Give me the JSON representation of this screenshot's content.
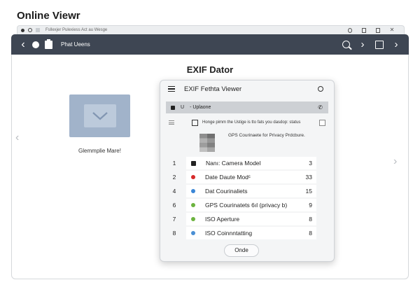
{
  "app_title": "Online Viewr",
  "browser_bar": {
    "tabs_text": "Fsllexjer  Pulexiess   Act au Wesge"
  },
  "toolbar": {
    "title": "Phat Ueens",
    "bg_color": "#3e4653"
  },
  "main": {
    "heading": "EXIF Dator",
    "thumbnail_caption": "Glemmplie Mare!"
  },
  "dialog": {
    "title": "EXIF Fethta Viewer",
    "subbar_lock_label": "U",
    "subbar_label": "- Uplaone",
    "message": "Honge pimm the Ustige is tto fats you dasdop: status",
    "gps_note": "GPS Courinaete for Privacy Prdcbure.",
    "rows": [
      {
        "num": "1",
        "label": "Nanı: Camera Model",
        "value": "3",
        "icon_color": "#222222",
        "icon": "document-icon"
      },
      {
        "num": "2",
        "label": "Date Daute Modᶜ",
        "value": "33",
        "icon_color": "#d62a2a",
        "icon": "red-dot-icon"
      },
      {
        "num": "4",
        "label": "Dat Courinaliets",
        "value": "15",
        "icon_color": "#3a86d6",
        "icon": "blue-dot-icon"
      },
      {
        "num": "6",
        "label": "GPS Courinatets 6ıl (privacy b)",
        "value": "9",
        "icon_color": "#6cb33f",
        "icon": "green-dot-icon"
      },
      {
        "num": "7",
        "label": "ISO Aperture",
        "value": "8",
        "icon_color": "#6cb33f",
        "icon": "green-dot-icon"
      },
      {
        "num": "8",
        "label": "ISO Coinnntatting",
        "value": "8",
        "icon_color": "#4a8fd4",
        "icon": "blue-dot-icon"
      }
    ],
    "done_label": "Onde"
  }
}
